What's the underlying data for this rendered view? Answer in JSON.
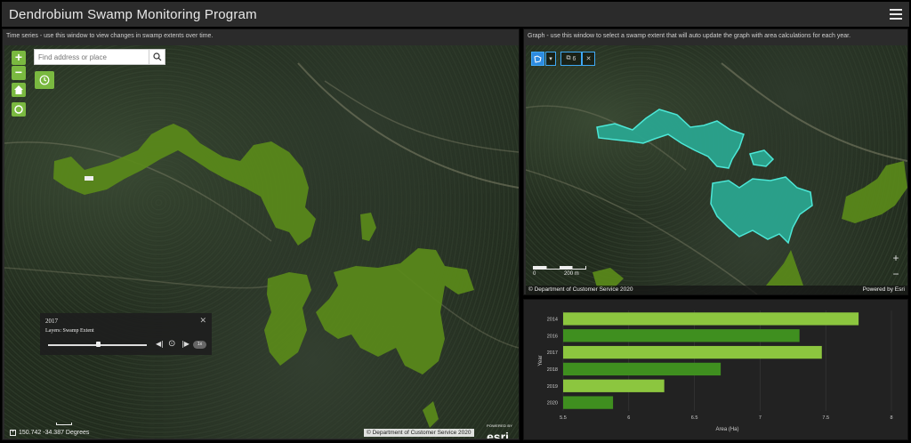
{
  "app": {
    "title": "Dendrobium Swamp Monitoring Program"
  },
  "left_panel": {
    "title": "Time series - use this window to view changes in swamp extents over time.",
    "search": {
      "placeholder": "Find address or place"
    },
    "time_slider": {
      "year": "2017",
      "layers_label": "Layers: Swamp Extent",
      "speed": "1x",
      "position": 0.5
    },
    "coordinates": "150.742 -34.387 Degrees",
    "attribution": "© Department of Customer Service 2020",
    "esri_powered": "POWERED BY",
    "esri_brand": "esri"
  },
  "graph_panel": {
    "title": "Graph - use this window to select a swamp extent that will auto update the graph with area calculations for each year.",
    "selection_count": "6",
    "scale_label_0": "0",
    "scale_label_end": "200 m",
    "attribution": "© Department of Customer Service 2020",
    "powered": "Powered by Esri"
  },
  "colors": {
    "accent": "#7ab940",
    "swamp_fill": "#5a8a1a",
    "selection": "#35d6c8",
    "bar_light": "#8cc63f",
    "bar_dark": "#3f8f1f"
  },
  "chart_data": {
    "type": "bar",
    "orientation": "horizontal",
    "categories": [
      "2014",
      "2016",
      "2017",
      "2018",
      "2019",
      "2020"
    ],
    "values": [
      7.75,
      7.3,
      7.47,
      6.7,
      6.27,
      5.88
    ],
    "xlabel": "Area (Ha)",
    "ylabel": "Year",
    "xlim": [
      5.5,
      8
    ],
    "xticks": [
      "5.5",
      "6",
      "6.5",
      "7",
      "7.5",
      "8"
    ],
    "bar_colors": [
      "#8cc63f",
      "#3f8f1f",
      "#8cc63f",
      "#3f8f1f",
      "#8cc63f",
      "#3f8f1f"
    ],
    "grid": true
  }
}
